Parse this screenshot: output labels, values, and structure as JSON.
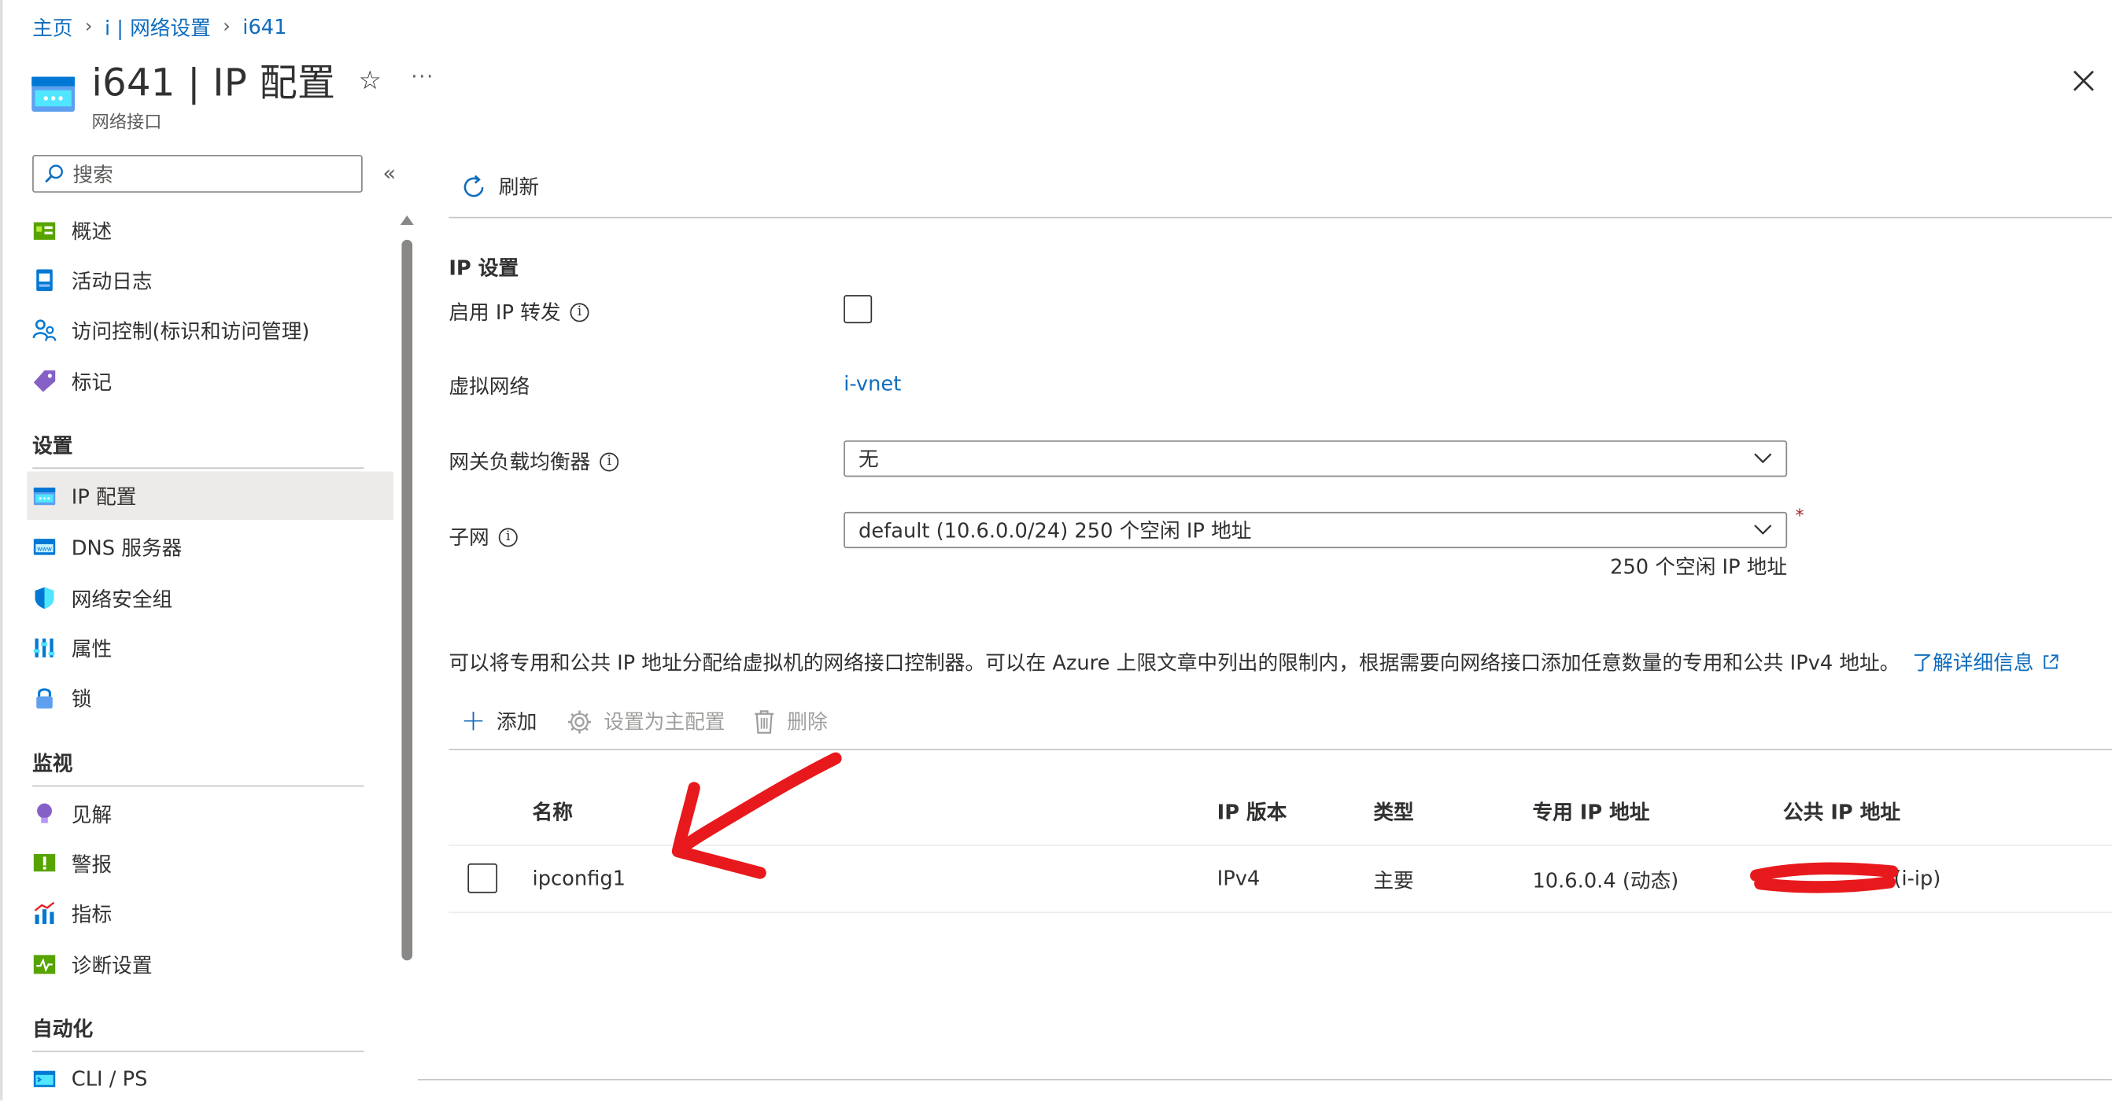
{
  "breadcrumb": {
    "home": "主页",
    "parent": "i | 网络设置",
    "current": "i641"
  },
  "header": {
    "title": "i641 | IP 配置",
    "subtitle": "网络接口",
    "favorite_icon": "star-icon",
    "more_icon": "ellipsis-icon",
    "close_icon": "close-icon"
  },
  "sidebar": {
    "search_placeholder": "搜索",
    "collapse_glyph": "«",
    "top_items": [
      {
        "label": "概述",
        "icon": "overview-icon"
      },
      {
        "label": "活动日志",
        "icon": "activity-log-icon"
      },
      {
        "label": "访问控制(标识和访问管理)",
        "icon": "iam-icon"
      },
      {
        "label": "标记",
        "icon": "tag-icon"
      }
    ],
    "sections": [
      {
        "title": "设置",
        "items": [
          {
            "label": "IP 配置",
            "icon": "ip-config-icon",
            "active": true
          },
          {
            "label": "DNS 服务器",
            "icon": "dns-icon"
          },
          {
            "label": "网络安全组",
            "icon": "shield-icon"
          },
          {
            "label": "属性",
            "icon": "properties-icon"
          },
          {
            "label": "锁",
            "icon": "lock-icon"
          }
        ]
      },
      {
        "title": "监视",
        "items": [
          {
            "label": "见解",
            "icon": "insights-icon"
          },
          {
            "label": "警报",
            "icon": "alert-icon"
          },
          {
            "label": "指标",
            "icon": "metrics-icon"
          },
          {
            "label": "诊断设置",
            "icon": "diagnostics-icon"
          }
        ]
      },
      {
        "title": "自动化",
        "items": [
          {
            "label": "CLI / PS",
            "icon": "cli-icon"
          }
        ]
      }
    ]
  },
  "toolbar": {
    "refresh_label": "刷新"
  },
  "ip_settings": {
    "heading": "IP 设置",
    "forwarding_label": "启用 IP 转发",
    "forwarding_checked": false,
    "vnet_label": "虚拟网络",
    "vnet_value": "i-vnet",
    "gateway_lb_label": "网关负载均衡器",
    "gateway_lb_value": "无",
    "subnet_label": "子网",
    "subnet_value": "default (10.6.0.0/24) 250 个空闲 IP 地址",
    "subnet_required": "*",
    "subnet_helper": "250 个空闲 IP 地址"
  },
  "description": {
    "text": "可以将专用和公共 IP 地址分配给虚拟机的网络接口控制器。可以在 Azure 上限文章中列出的限制内，根据需要向网络接口添加任意数量的专用和公共 IPv4 地址。",
    "link": "了解详细信息"
  },
  "table_toolbar": {
    "add_label": "添加",
    "set_primary_label": "设置为主配置",
    "delete_label": "删除"
  },
  "table": {
    "columns": [
      "名称",
      "IP 版本",
      "类型",
      "专用 IP 地址",
      "公共 IP 地址"
    ],
    "rows": [
      {
        "name": "ipconfig1",
        "ip_version": "IPv4",
        "type": "主要",
        "private_ip": "10.6.0.4 (动态)",
        "public_ip": "(i-ip)"
      }
    ]
  },
  "colors": {
    "link": "#0f6cbd",
    "annotation": "#e8191c",
    "active_nav": "#edebe9"
  }
}
